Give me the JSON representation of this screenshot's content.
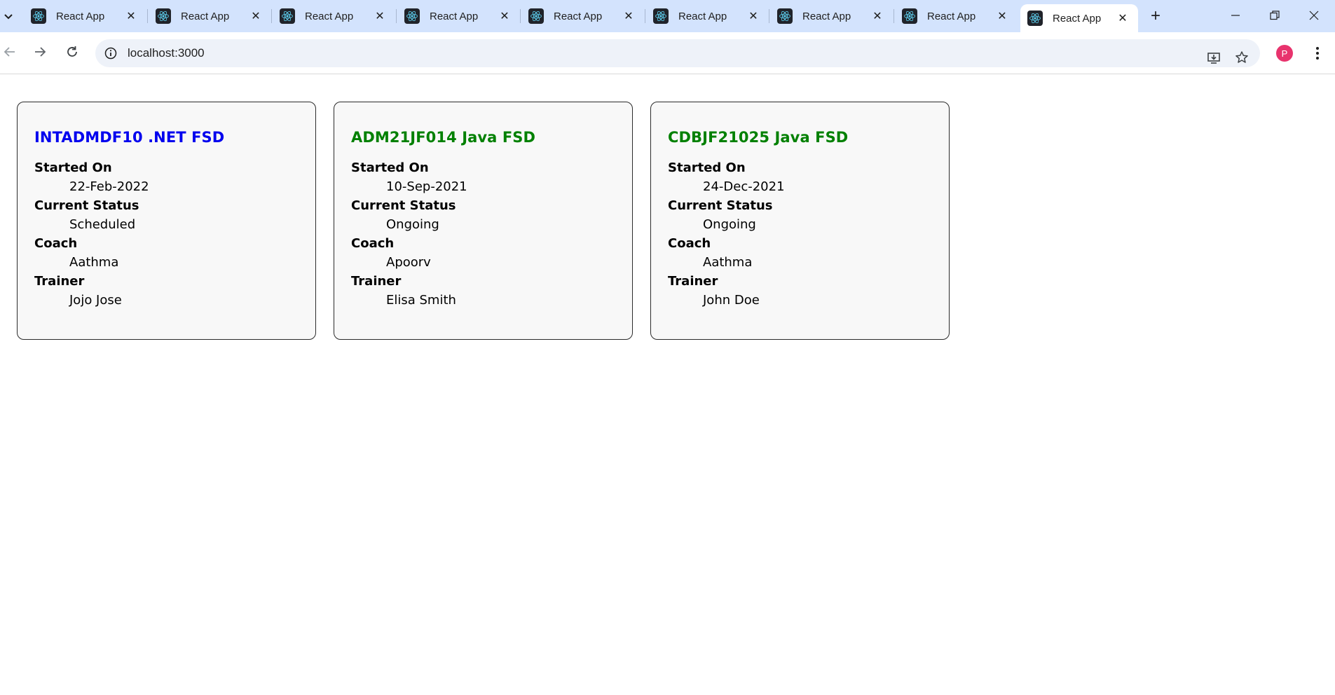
{
  "browser": {
    "tabs": [
      {
        "title": "React App",
        "active": false
      },
      {
        "title": "React App",
        "active": false
      },
      {
        "title": "React App",
        "active": false
      },
      {
        "title": "React App",
        "active": false
      },
      {
        "title": "React App",
        "active": false
      },
      {
        "title": "React App",
        "active": false
      },
      {
        "title": "React App",
        "active": false
      },
      {
        "title": "React App",
        "active": false
      },
      {
        "title": "React App",
        "active": true
      }
    ],
    "url": "localhost:3000",
    "profile_initial": "P"
  },
  "colors": {
    "title_blue": "#0000ee",
    "title_green": "#008000",
    "tab_strip": "#d3e3fd",
    "avatar": "#e8336d"
  },
  "cohorts": [
    {
      "title": "INTADMDF10 .NET FSD",
      "title_color": "#0000ee",
      "started_label": "Started On",
      "started": "22-Feb-2022",
      "status_label": "Current Status",
      "status": "Scheduled",
      "coach_label": "Coach",
      "coach": "Aathma",
      "trainer_label": "Trainer",
      "trainer": "Jojo Jose"
    },
    {
      "title": "ADM21JF014 Java FSD",
      "title_color": "#008000",
      "started_label": "Started On",
      "started": "10-Sep-2021",
      "status_label": "Current Status",
      "status": "Ongoing",
      "coach_label": "Coach",
      "coach": "Apoorv",
      "trainer_label": "Trainer",
      "trainer": "Elisa Smith"
    },
    {
      "title": "CDBJF21025 Java FSD",
      "title_color": "#008000",
      "started_label": "Started On",
      "started": "24-Dec-2021",
      "status_label": "Current Status",
      "status": "Ongoing",
      "coach_label": "Coach",
      "coach": "Aathma",
      "trainer_label": "Trainer",
      "trainer": "John Doe"
    }
  ]
}
